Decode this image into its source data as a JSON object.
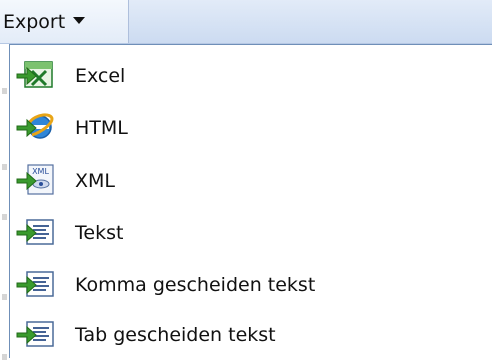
{
  "toolbar": {
    "export_label": "Export",
    "caret_icon": "caret-down-icon"
  },
  "menu": {
    "items": [
      {
        "label": "Excel",
        "icon": "excel-icon"
      },
      {
        "label": "HTML",
        "icon": "html-ie-icon"
      },
      {
        "label": "XML",
        "icon": "xml-icon"
      },
      {
        "label": "Tekst",
        "icon": "text-document-icon"
      },
      {
        "label": "Komma gescheiden tekst",
        "icon": "text-document-icon"
      },
      {
        "label": "Tab gescheiden tekst",
        "icon": "text-document-icon"
      }
    ]
  },
  "colors": {
    "arrow_green": "#3a9a2e",
    "excel_green": "#1f7a2a",
    "ie_blue": "#1f6fc7",
    "menu_border": "#6f8fb8"
  }
}
